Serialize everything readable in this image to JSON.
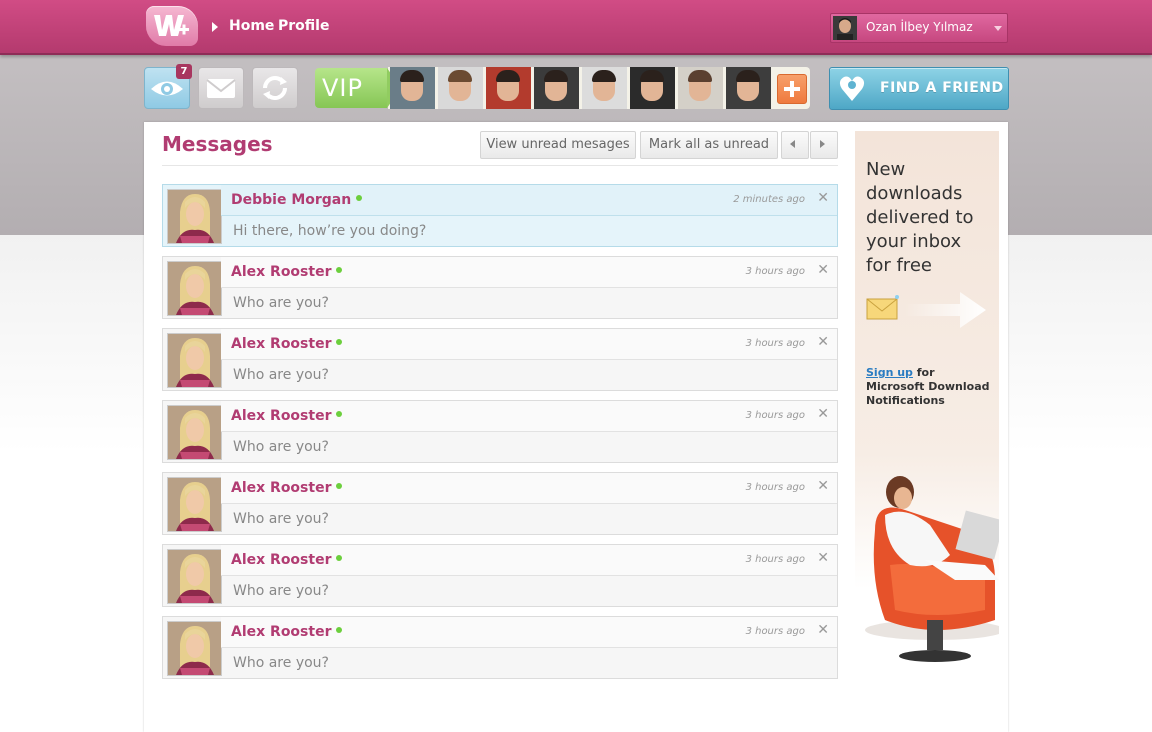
{
  "nav": {
    "home": "Home",
    "profile": "Profile"
  },
  "user": {
    "name": "Ozan İlbey Yılmaz"
  },
  "toolbar": {
    "notifications_count": "7",
    "vip_label": "VIP",
    "find_friend": "FIND A FRIEND"
  },
  "messages_page": {
    "title": "Messages",
    "view_unread": "View unread mesages",
    "mark_all_unread": "Mark all as unread"
  },
  "messages": [
    {
      "name": "Debbie Morgan",
      "time": "2 minutes ago",
      "text": "Hi there, how’re you doing?",
      "active": true
    },
    {
      "name": "Alex Rooster",
      "time": "3 hours ago",
      "text": "Who are you?",
      "active": false
    },
    {
      "name": "Alex Rooster",
      "time": "3 hours ago",
      "text": "Who are you?",
      "active": false
    },
    {
      "name": "Alex Rooster",
      "time": "3 hours ago",
      "text": "Who are you?",
      "active": false
    },
    {
      "name": "Alex Rooster",
      "time": "3 hours ago",
      "text": "Who are you?",
      "active": false
    },
    {
      "name": "Alex Rooster",
      "time": "3 hours ago",
      "text": "Who are you?",
      "active": false
    },
    {
      "name": "Alex Rooster",
      "time": "3 hours ago",
      "text": "Who are you?",
      "active": false
    }
  ],
  "ad": {
    "headline": "New downloads delivered to your inbox for free",
    "signup_link": "Sign up",
    "signup_rest": " for Microsoft Download Notifications"
  },
  "colors": {
    "brand_pink": "#b13c72",
    "online_green": "#6ccf3d",
    "find_friend_blue": "#4ea7c6"
  }
}
